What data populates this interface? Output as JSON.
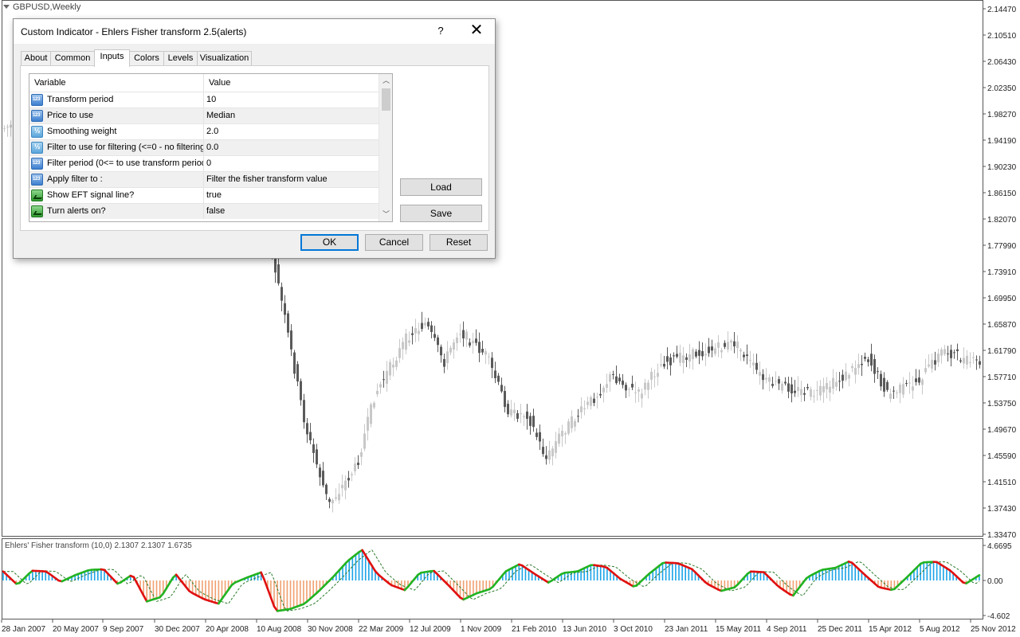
{
  "window": {
    "symbol_title": "GBPUSD,Weekly",
    "indicator_title": "Ehlers' Fisher transform (10,0) 2.1307 2.1307 1.6735"
  },
  "dialog": {
    "title": "Custom Indicator - Ehlers Fisher transform 2.5(alerts)",
    "help_label": "?",
    "close_label": "✕",
    "tabs": [
      {
        "label": "About"
      },
      {
        "label": "Common"
      },
      {
        "label": "Inputs",
        "active": true
      },
      {
        "label": "Colors"
      },
      {
        "label": "Levels"
      },
      {
        "label": "Visualization"
      }
    ],
    "grid": {
      "columns": [
        "Variable",
        "Value"
      ],
      "rows": [
        {
          "icon": "int-param-icon",
          "variable": "Transform period",
          "value": "10"
        },
        {
          "icon": "int-param-icon",
          "variable": "Price to use",
          "value": "Median"
        },
        {
          "icon": "double-param-icon",
          "variable": "Smoothing weight",
          "value": "2.0"
        },
        {
          "icon": "double-param-icon",
          "variable": "Filter to use for filtering (<=0 - no filtering)",
          "value": "0.0"
        },
        {
          "icon": "int-param-icon",
          "variable": "Filter period (0<= to use transform period)",
          "value": "0"
        },
        {
          "icon": "int-param-icon",
          "variable": "Apply filter to :",
          "value": "Filter the fisher transform value"
        },
        {
          "icon": "bool-param-icon",
          "variable": "Show EFT signal line?",
          "value": "true"
        },
        {
          "icon": "bool-param-icon",
          "variable": "Turn alerts on?",
          "value": "false"
        }
      ]
    },
    "buttons": {
      "load": "Load",
      "save": "Save",
      "ok": "OK",
      "cancel": "Cancel",
      "reset": "Reset"
    }
  },
  "price_axis": [
    "2.14470",
    "2.10510",
    "2.06430",
    "2.02350",
    "1.98270",
    "1.94190",
    "1.90230",
    "1.86150",
    "1.82070",
    "1.77990",
    "1.73910",
    "1.69950",
    "1.65870",
    "1.61790",
    "1.57710",
    "1.53750",
    "1.49670",
    "1.45590",
    "1.41510",
    "1.37430",
    "1.33470"
  ],
  "indicator_axis": [
    "4.6695",
    "0.00",
    "-4.602"
  ],
  "date_axis": [
    "28 Jan 2007",
    "20 May 2007",
    "9 Sep 2007",
    "30 Dec 2007",
    "20 Apr 2008",
    "10 Aug 2008",
    "30 Nov 2008",
    "22 Mar 2009",
    "12 Jul 2009",
    "1 Nov 2009",
    "21 Feb 2010",
    "13 Jun 2010",
    "3 Oct 2010",
    "23 Jan 2011",
    "15 May 2011",
    "4 Sep 2011",
    "25 Dec 2011",
    "15 Apr 2012",
    "5 Aug 2012",
    "25 Nov 2012"
  ],
  "colors": {
    "up_candle": "#c8c8c8",
    "down_candle": "#5a5a5a",
    "hist_positive": "#1aa3e8",
    "hist_negative": "#f0a070",
    "fisher_up": "#22b322",
    "fisher_down": "#e01010",
    "signal_line": "#2a7a2a",
    "dialog_accent": "#0078d7"
  },
  "chart_data": [
    {
      "type": "candlestick",
      "title": "GBPUSD,Weekly",
      "ylim": [
        1.3347,
        2.1447
      ],
      "x_range": [
        "28 Jan 2007",
        "25 Nov 2012"
      ],
      "close_path": [
        [
          "28 Jan 2007",
          1.96
        ],
        [
          "20 May 2007",
          1.98
        ],
        [
          "9 Sep 2007",
          2.01
        ],
        [
          "30 Dec 2007",
          1.98
        ],
        [
          "20 Apr 2008",
          1.97
        ],
        [
          "10 Aug 2008",
          1.9
        ],
        [
          "1 Oct 2008",
          1.72
        ],
        [
          "30 Nov 2008",
          1.5
        ],
        [
          "20 Jan 2009",
          1.38
        ],
        [
          "22 Mar 2009",
          1.44
        ],
        [
          "1 May 2009",
          1.55
        ],
        [
          "12 Jul 2009",
          1.64
        ],
        [
          "20 Aug 2009",
          1.66
        ],
        [
          "1 Oct 2009",
          1.6
        ],
        [
          "1 Nov 2009",
          1.65
        ],
        [
          "1 Jan 2010",
          1.61
        ],
        [
          "21 Feb 2010",
          1.52
        ],
        [
          "1 Apr 2010",
          1.52
        ],
        [
          "13 May 2010",
          1.45
        ],
        [
          "13 Jun 2010",
          1.49
        ],
        [
          "1 Sep 2010",
          1.55
        ],
        [
          "3 Oct 2010",
          1.58
        ],
        [
          "1 Dec 2010",
          1.55
        ],
        [
          "23 Jan 2011",
          1.6
        ],
        [
          "15 May 2011",
          1.62
        ],
        [
          "1 Jul 2011",
          1.63
        ],
        [
          "4 Sep 2011",
          1.57
        ],
        [
          "25 Dec 2011",
          1.55
        ],
        [
          "1 Mar 2012",
          1.58
        ],
        [
          "15 Apr 2012",
          1.61
        ],
        [
          "1 Jun 2012",
          1.55
        ],
        [
          "5 Aug 2012",
          1.57
        ],
        [
          "1 Oct 2012",
          1.62
        ],
        [
          "25 Nov 2012",
          1.6
        ]
      ]
    },
    {
      "type": "line",
      "title": "Ehlers' Fisher transform (10,0) 2.1307 2.1307 1.6735",
      "ylim": [
        -4.602,
        4.6695
      ],
      "series": [
        {
          "name": "Fisher",
          "values": [
            1.2,
            -0.6,
            1.3,
            1.2,
            -0.2,
            0.7,
            1.4,
            1.5,
            -0.5,
            0.8,
            -2.8,
            -2.2,
            0.9,
            -1.5,
            -2.5,
            -3.1,
            -0.4,
            0.4,
            1.1,
            -4.1,
            -3.8,
            -3.1,
            -1.4,
            0.5,
            2.6,
            4.1,
            1.0,
            -0.6,
            -1.3,
            1.0,
            1.3,
            -0.6,
            -2.6,
            -1.7,
            -1.1,
            1.2,
            2.2,
            0.9,
            -0.3,
            1.0,
            1.2,
            2.1,
            1.8,
            0.2,
            -0.9,
            0.9,
            2.4,
            2.3,
            1.5,
            -0.4,
            -1.4,
            -0.9,
            1.2,
            1.1,
            -0.8,
            -2.1,
            0.4,
            1.4,
            1.7,
            2.6,
            0.8,
            -0.9,
            -1.3,
            0.5,
            2.4,
            2.5,
            1.3,
            -0.5,
            0.7
          ]
        }
      ]
    }
  ]
}
